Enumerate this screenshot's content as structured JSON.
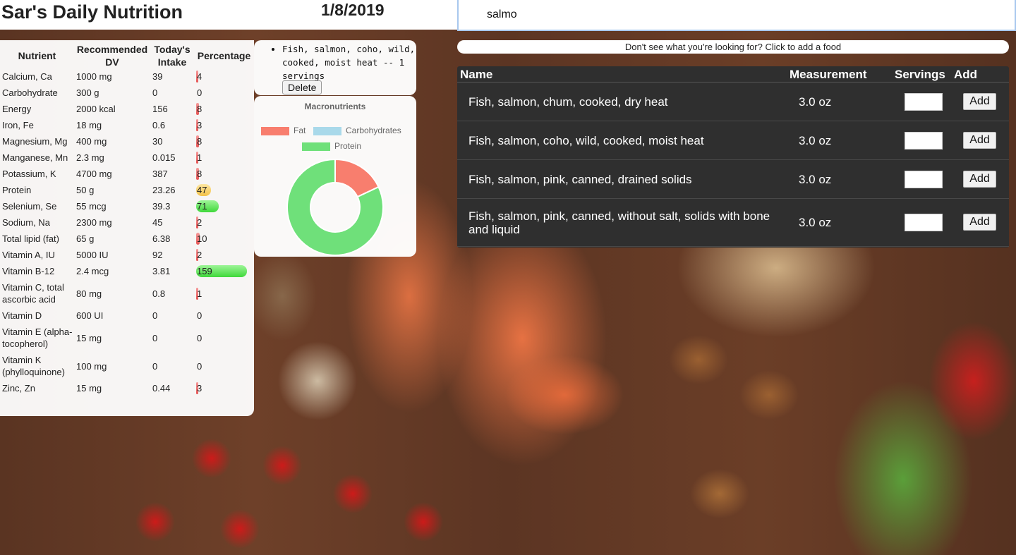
{
  "header": {
    "title": "Sar's Daily Nutrition",
    "date": "1/8/2019"
  },
  "search": {
    "value": "salmo"
  },
  "nutrient_table": {
    "headers": [
      "Nutrient",
      "Recommended DV",
      "Today's Intake",
      "Percentage"
    ],
    "rows": [
      {
        "nutrient": "Calcium, Ca",
        "dv": "1000 mg",
        "intake": "39",
        "pct": "4",
        "level": "low"
      },
      {
        "nutrient": "Carbohydrate",
        "dv": "300 g",
        "intake": "0",
        "pct": "0",
        "level": "none"
      },
      {
        "nutrient": "Energy",
        "dv": "2000 kcal",
        "intake": "156",
        "pct": "8",
        "level": "low"
      },
      {
        "nutrient": "Iron, Fe",
        "dv": "18 mg",
        "intake": "0.6",
        "pct": "3",
        "level": "low"
      },
      {
        "nutrient": "Magnesium, Mg",
        "dv": "400 mg",
        "intake": "30",
        "pct": "8",
        "level": "low"
      },
      {
        "nutrient": "Manganese, Mn",
        "dv": "2.3 mg",
        "intake": "0.015",
        "pct": "1",
        "level": "low"
      },
      {
        "nutrient": "Potassium, K",
        "dv": "4700 mg",
        "intake": "387",
        "pct": "8",
        "level": "low"
      },
      {
        "nutrient": "Protein",
        "dv": "50 g",
        "intake": "23.26",
        "pct": "47",
        "level": "mid"
      },
      {
        "nutrient": "Selenium, Se",
        "dv": "55 mcg",
        "intake": "39.3",
        "pct": "71",
        "level": "high"
      },
      {
        "nutrient": "Sodium, Na",
        "dv": "2300 mg",
        "intake": "45",
        "pct": "2",
        "level": "low"
      },
      {
        "nutrient": "Total lipid (fat)",
        "dv": "65 g",
        "intake": "6.38",
        "pct": "10",
        "level": "low"
      },
      {
        "nutrient": "Vitamin A, IU",
        "dv": "5000 IU",
        "intake": "92",
        "pct": "2",
        "level": "low"
      },
      {
        "nutrient": "Vitamin B-12",
        "dv": "2.4 mcg",
        "intake": "3.81",
        "pct": "159",
        "level": "high"
      },
      {
        "nutrient": "Vitamin C, total ascorbic acid",
        "dv": "80 mg",
        "intake": "0.8",
        "pct": "1",
        "level": "low"
      },
      {
        "nutrient": "Vitamin D",
        "dv": "600 UI",
        "intake": "0",
        "pct": "0",
        "level": "none"
      },
      {
        "nutrient": "Vitamin E (alpha-tocopherol)",
        "dv": "15 mg",
        "intake": "0",
        "pct": "0",
        "level": "none"
      },
      {
        "nutrient": "Vitamin K (phylloquinone)",
        "dv": "100 mg",
        "intake": "0",
        "pct": "0",
        "level": "none"
      },
      {
        "nutrient": "Zinc, Zn",
        "dv": "15 mg",
        "intake": "0.44",
        "pct": "3",
        "level": "low"
      }
    ]
  },
  "bar_colors": {
    "low": "#e65454",
    "mid": "#f4c248",
    "high": "#3fd83a"
  },
  "log": {
    "items": [
      "Fish, salmon, coho, wild, cooked, moist heat -- 1 servings"
    ],
    "delete_label": "Delete"
  },
  "macro_chart": {
    "title": "Macronutrients",
    "legend": [
      {
        "name": "Fat",
        "color": "#f87e6e"
      },
      {
        "name": "Carbohydrates",
        "color": "#a9d9ea"
      },
      {
        "name": "Protein",
        "color": "#6fe07a"
      }
    ]
  },
  "chart_data": {
    "type": "pie",
    "title": "Macronutrients",
    "categories": [
      "Fat",
      "Carbohydrates",
      "Protein"
    ],
    "values": [
      18,
      0,
      82
    ],
    "colors": [
      "#f87e6e",
      "#a9d9ea",
      "#6fe07a"
    ],
    "donut": true,
    "legend_position": "top"
  },
  "add_food_link": "Don't see what you're looking for? Click to add a food",
  "results": {
    "headers": {
      "name": "Name",
      "measurement": "Measurement",
      "servings": "Servings",
      "add": "Add"
    },
    "rows": [
      {
        "name": "Fish, salmon, chum, cooked, dry heat",
        "measurement": "3.0 oz",
        "add_label": "Add"
      },
      {
        "name": "Fish, salmon, coho, wild, cooked, moist heat",
        "measurement": "3.0 oz",
        "add_label": "Add"
      },
      {
        "name": "Fish, salmon, pink, canned, drained solids",
        "measurement": "3.0 oz",
        "add_label": "Add"
      },
      {
        "name": "Fish, salmon, pink, canned, without salt, solids with bone and liquid",
        "measurement": "3.0 oz",
        "add_label": "Add"
      }
    ]
  }
}
